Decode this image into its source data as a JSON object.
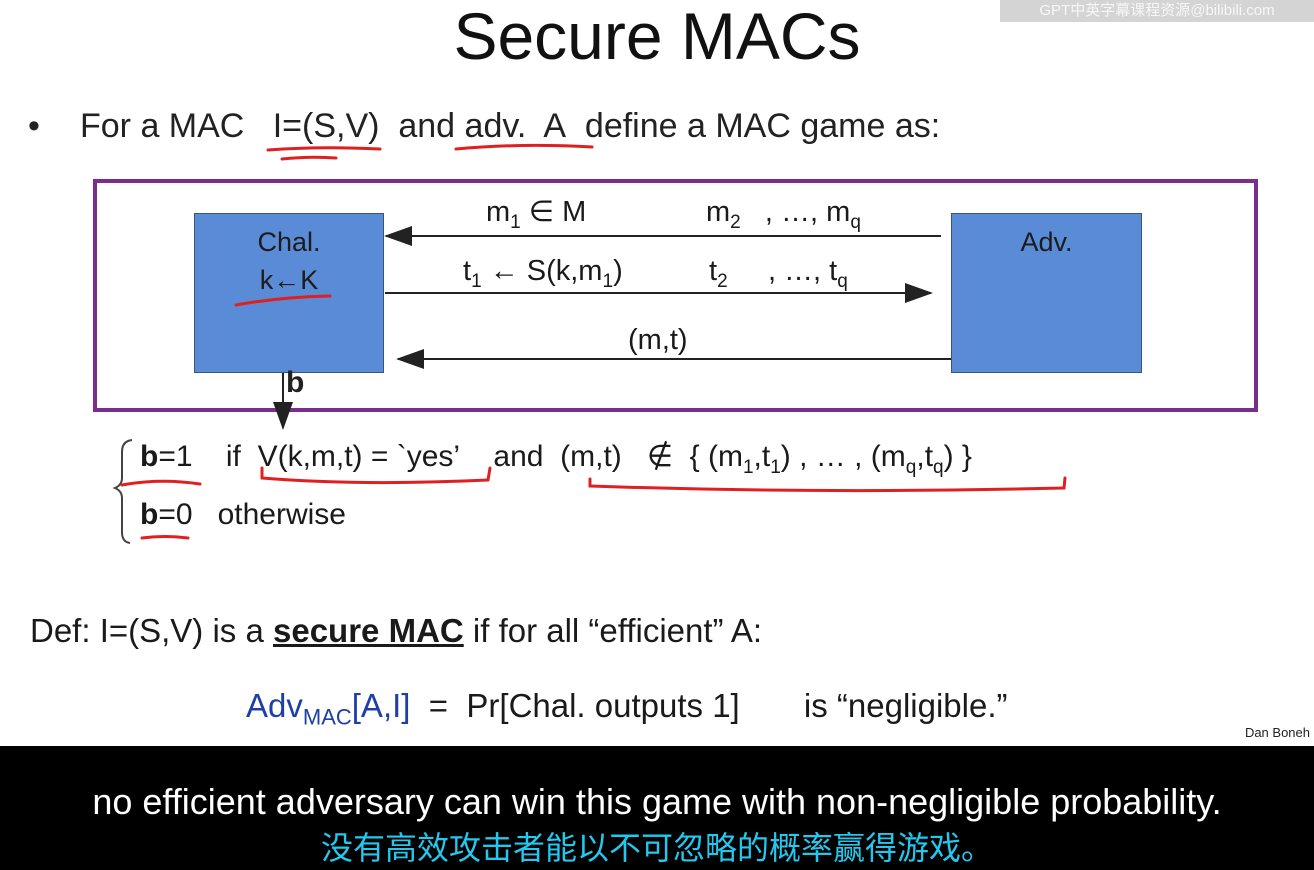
{
  "watermark": "GPT中英字幕课程资源@bilibili.com",
  "title": "Secure MACs",
  "intro": {
    "bullet": "•",
    "prefix": "For a MAC",
    "mac": "I=(S,V)",
    "middle": "and",
    "adv": "adv.",
    "advname": "A",
    "suffix": "define a MAC game as:"
  },
  "game": {
    "challenger_label": "Chal.",
    "challenger_key": "k←K",
    "adversary_label": "Adv.",
    "query_first": "m",
    "query_first_sub": "1",
    "query_first_set": " ∈ M",
    "query_second": "m",
    "query_second_sub": "2",
    "query_ellipsis": ", …, m",
    "query_last_sub": "q",
    "tag_first": "t",
    "tag_first_sub": "1",
    "tag_first_expr": " ← S(k,m",
    "tag_first_expr_sub": "1",
    "tag_first_close": ")",
    "tag_second": "t",
    "tag_second_sub": "2",
    "tag_ellipsis": ", …, t",
    "tag_last_sub": "q",
    "forgery": "(m,t)",
    "output_bit": "b"
  },
  "conditions": {
    "b_label": "b",
    "eq1": "=1",
    "if": "if",
    "verify": "V(k,m,t) = `yes’",
    "and": "and",
    "pair": "(m,t)",
    "notin": "∉",
    "set_open": "{ (m",
    "s1": "1",
    "comma_t": ",t",
    "s2": "1",
    "set_mid": ") , … , (m",
    "s3": "q",
    "comma_t2": ",t",
    "s4": "q",
    "set_close": ") }",
    "eq0": "=0",
    "otherwise": "otherwise"
  },
  "definition": {
    "prefix": "Def:  I=(S,V)  is a ",
    "bold": "secure MAC",
    "suffix": " if for all “efficient” A:"
  },
  "advantage": {
    "adv": "Adv",
    "sub": "MAC",
    "args": "[A,I]",
    "rest": "  =  Pr[Chal. outputs 1]       is “negligible.”"
  },
  "author": "Dan Boneh",
  "subtitles": {
    "english": "no efficient adversary can win this game with non-negligible probability.",
    "chinese": "没有高效攻击者能以不可忽略的概率赢得游戏。"
  },
  "colors": {
    "frame": "#7b2d8e",
    "box": "#5a8bd6",
    "annotation": "#e02020",
    "formula_blue": "#1f3ea8",
    "subtitle_zh": "#22c8ee"
  }
}
